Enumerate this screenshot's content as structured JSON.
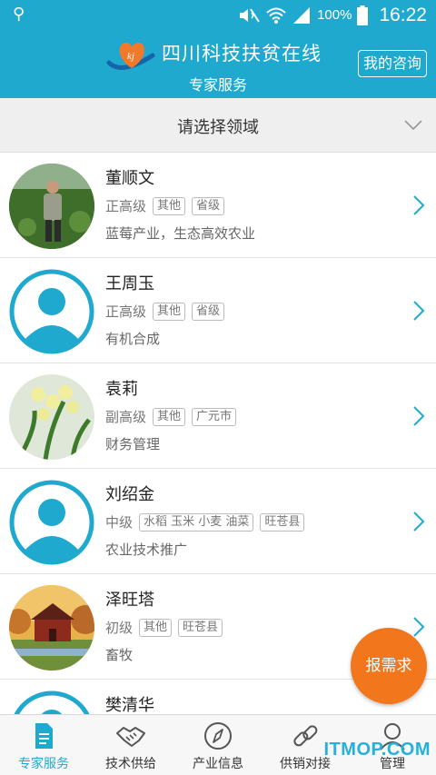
{
  "status_bar": {
    "battery_percent": "100%",
    "time": "16:22"
  },
  "header": {
    "logo_text": "kj",
    "title": "四川科技扶贫在线",
    "subtitle": "专家服务",
    "consult_button": "我的咨询"
  },
  "filter": {
    "label": "请选择领域"
  },
  "experts": [
    {
      "name": "董顺文",
      "level": "正高级",
      "tags": [
        "其他",
        "省级"
      ],
      "desc": "蓝莓产业，生态高效农业",
      "avatar": "photo-farmer"
    },
    {
      "name": "王周玉",
      "level": "正高级",
      "tags": [
        "其他",
        "省级"
      ],
      "desc": "有机合成",
      "avatar": "default-user"
    },
    {
      "name": "袁莉",
      "level": "副高级",
      "tags": [
        "其他",
        "广元市"
      ],
      "desc": "财务管理",
      "avatar": "photo-orchid"
    },
    {
      "name": "刘绍金",
      "level": "中级",
      "tags": [
        "水稻 玉米 小麦 油菜",
        "旺苍县"
      ],
      "desc": "农业技术推广",
      "avatar": "default-user"
    },
    {
      "name": "泽旺塔",
      "level": "初级",
      "tags": [
        "其他",
        "旺苍县"
      ],
      "desc": "畜牧",
      "avatar": "photo-farmhouse"
    },
    {
      "name": "樊清华",
      "level": "",
      "tags": [],
      "desc": "",
      "avatar": "default-user"
    }
  ],
  "fab": {
    "label": "报需求"
  },
  "tabs": [
    {
      "label": "专家服务",
      "icon": "document-icon",
      "active": true
    },
    {
      "label": "技术供给",
      "icon": "handshake-icon",
      "active": false
    },
    {
      "label": "产业信息",
      "icon": "compass-icon",
      "active": false
    },
    {
      "label": "供销对接",
      "icon": "link-icon",
      "active": false
    },
    {
      "label": "管理",
      "icon": "user-icon",
      "active": false
    }
  ],
  "watermark": "ITMOP.COM",
  "colors": {
    "primary": "#1fa9cf",
    "accent": "#f2761c"
  }
}
